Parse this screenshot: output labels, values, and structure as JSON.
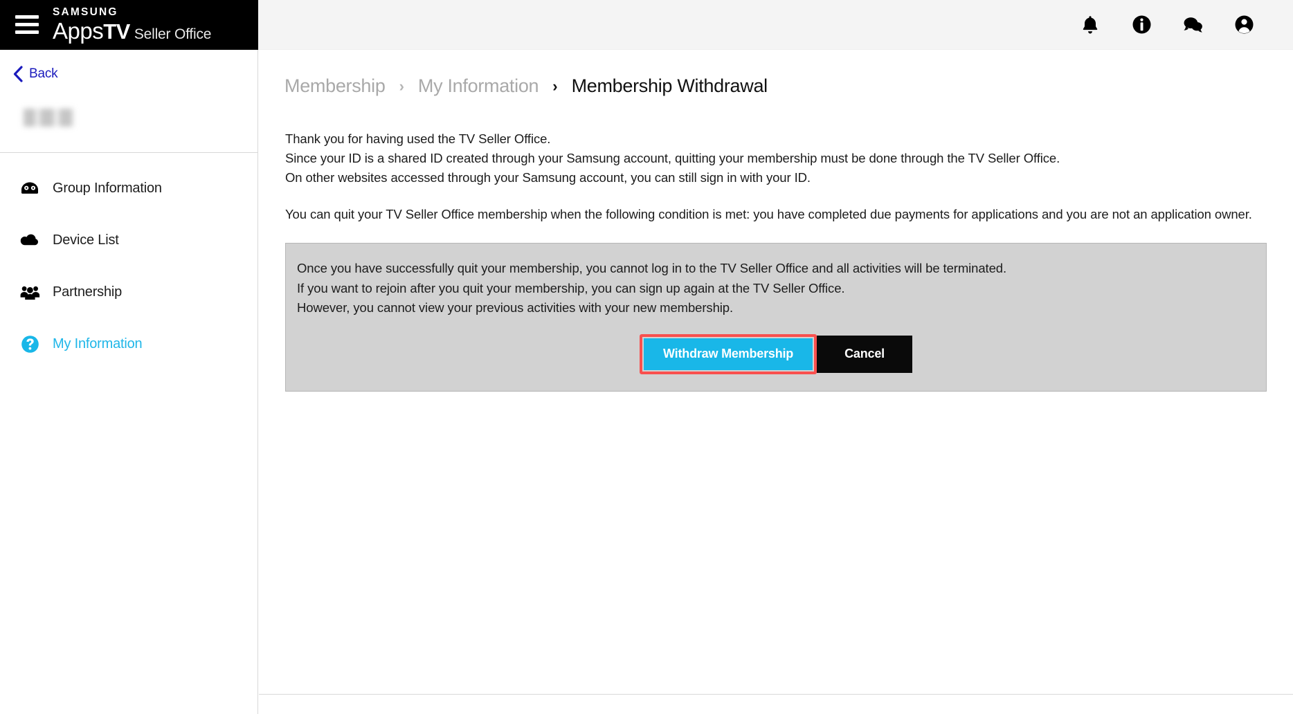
{
  "header": {
    "menu_icon": "hamburger-menu-icon",
    "brand": {
      "samsung": "SAMSUNG",
      "apps": "Apps",
      "tv": "TV",
      "seller_office": "Seller Office"
    },
    "icons": [
      {
        "name": "notifications-bell-icon",
        "label": "Notifications"
      },
      {
        "name": "info-circle-icon",
        "label": "Information"
      },
      {
        "name": "chat-bubbles-icon",
        "label": "Messages"
      },
      {
        "name": "user-account-icon",
        "label": "Account"
      }
    ]
  },
  "sidebar": {
    "back_label": "Back",
    "user_name_redacted": "",
    "items": [
      {
        "label": "Group Information",
        "icon": "group-information-icon",
        "active": false
      },
      {
        "label": "Device List",
        "icon": "cloud-icon",
        "active": false
      },
      {
        "label": "Partnership",
        "icon": "people-group-icon",
        "active": false
      },
      {
        "label": "My Information",
        "icon": "question-circle-icon",
        "active": true
      }
    ]
  },
  "breadcrumb": {
    "items": [
      "Membership",
      "My Information",
      "Membership Withdrawal"
    ],
    "separator": "›"
  },
  "main": {
    "intro": {
      "line1": "Thank you for having used the TV Seller Office.",
      "line2": "Since your ID is a shared ID created through your Samsung account, quitting your membership must be done through the TV Seller Office.",
      "line3": "On other websites accessed through your Samsung account, you can still sign in with your ID."
    },
    "condition": "You can quit your TV Seller Office membership when the following condition is met: you have completed due payments for applications and you are not an application owner.",
    "notice": {
      "line1": "Once you have successfully quit your membership, you cannot log in to the TV Seller Office and all activities will be terminated.",
      "line2": "If you want to rejoin after you quit your membership, you can sign up again at the TV Seller Office.",
      "line3": "However, you cannot view your previous activities with your new membership."
    },
    "buttons": {
      "withdraw": "Withdraw Membership",
      "cancel": "Cancel"
    }
  },
  "colors": {
    "accent_cyan": "#19b7e8",
    "highlight_red": "#f9504e",
    "notice_bg": "#d2d2d2",
    "brand_black": "#000000",
    "link_blue": "#1b1bbd"
  }
}
